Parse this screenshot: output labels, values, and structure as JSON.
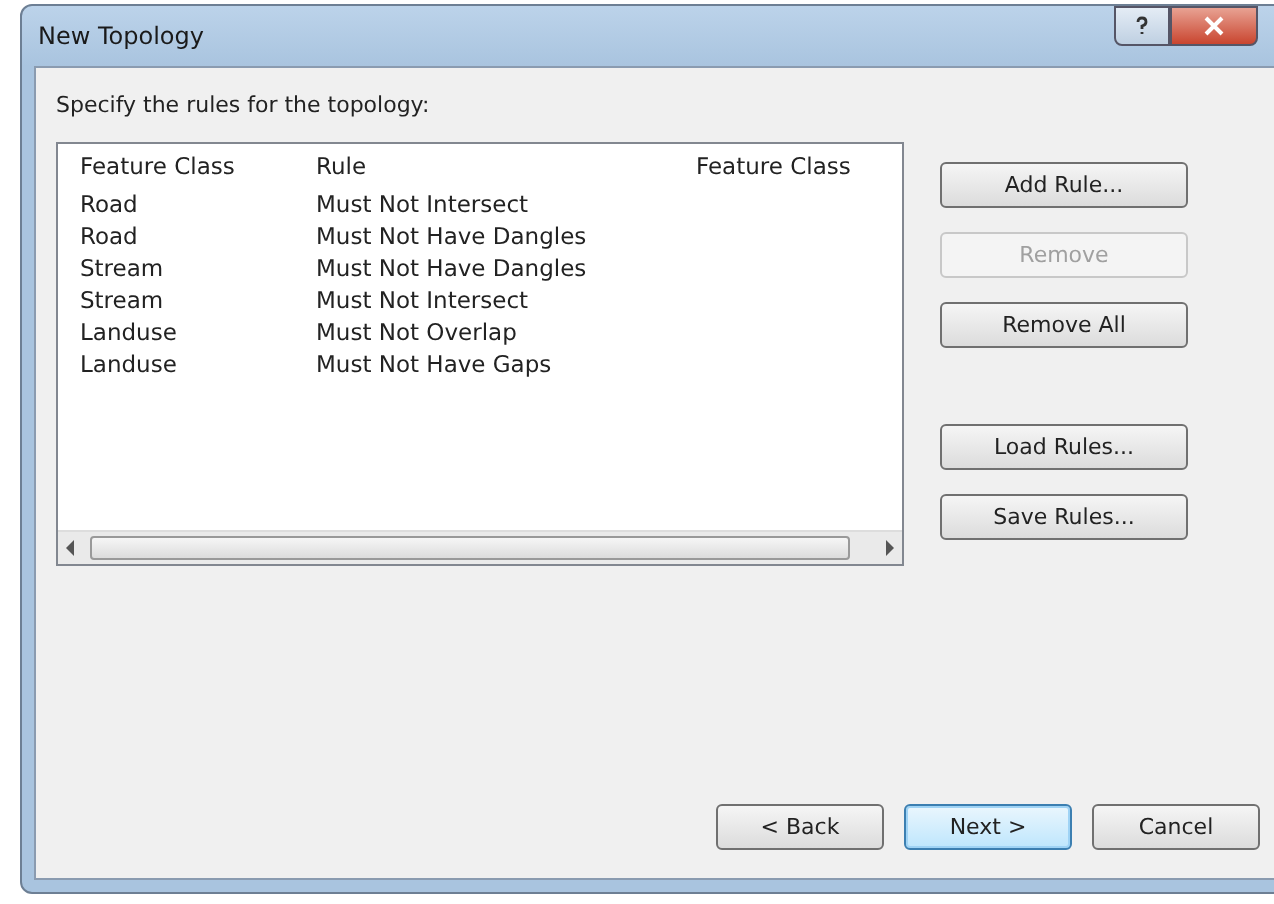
{
  "window": {
    "title": "New Topology"
  },
  "instruction": "Specify the rules for the topology:",
  "table": {
    "columns": [
      "Feature Class",
      "Rule",
      "Feature Class"
    ],
    "rows": [
      [
        "Road",
        "Must Not Intersect",
        ""
      ],
      [
        "Road",
        "Must Not Have Dangles",
        ""
      ],
      [
        "Stream",
        "Must Not Have Dangles",
        ""
      ],
      [
        "Stream",
        "Must Not Intersect",
        ""
      ],
      [
        "Landuse",
        "Must Not Overlap",
        ""
      ],
      [
        "Landuse",
        "Must Not Have Gaps",
        ""
      ]
    ]
  },
  "rule_buttons": [
    {
      "label": "Add Rule...",
      "disabled": false
    },
    {
      "label": "Remove",
      "disabled": true
    },
    {
      "label": "Remove All",
      "disabled": false
    }
  ],
  "file_buttons": [
    {
      "label": "Load Rules...",
      "disabled": false
    },
    {
      "label": "Save Rules...",
      "disabled": false
    }
  ],
  "nav_buttons": [
    {
      "label": "< Back",
      "default": false
    },
    {
      "label": "Next >",
      "default": true
    },
    {
      "label": "Cancel",
      "default": false
    }
  ]
}
